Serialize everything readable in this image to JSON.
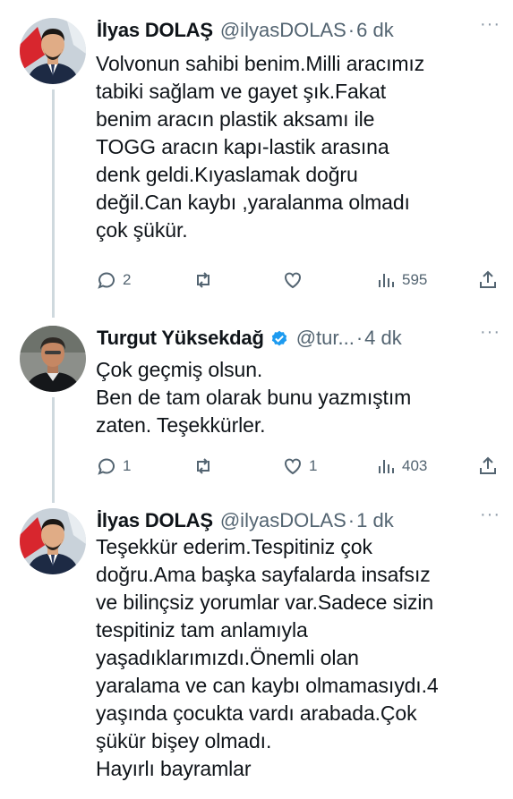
{
  "tweets": [
    {
      "name": "İlyas DOLAŞ",
      "handle": "@ilyasDOLAS",
      "time": "6 dk",
      "text": "Volvonun sahibi benim.Milli aracımız\ntabiki sağlam ve gayet şık.Fakat\nbenim aracın plastik aksamı ile\nTOGG aracın kapı-lastik arasına\ndenk geldi.Kıyaslamak doğru\ndeğil.Can kaybı ,yaralanma olmadı\nçok şükür.",
      "replies": "2",
      "retweets": "",
      "likes": "",
      "views": "595"
    },
    {
      "name": "Turgut Yüksekdağ",
      "handle": "@tur...",
      "time": "4 dk",
      "text": "Çok geçmiş olsun.\nBen de tam olarak bunu yazmıştım\nzaten. Teşekkürler.",
      "replies": "1",
      "retweets": "",
      "likes": "1",
      "views": "403"
    },
    {
      "name": "İlyas DOLAŞ",
      "handle": "@ilyasDOLAS",
      "time": "1 dk",
      "text": "Teşekkür ederim.Tespitiniz çok\ndoğru.Ama başka sayfalarda insafsız\nve bilinçsiz yorumlar var.Sadece sizin\ntespitiniz tam anlamıyla\nyaşadıklarımızdı.Önemli olan\nyaralama ve can kaybı olmamasıydı.4\nyaşında çocukta vardı arabada.Çok\nşükür bişey olmadı.\nHayırlı bayramlar"
    }
  ],
  "separator": "·",
  "more_icon": "···",
  "icons": {
    "reply": "reply-icon",
    "retweet": "retweet-icon",
    "like": "heart-icon",
    "views": "views-icon",
    "share": "share-icon",
    "verified": "verified-badge-icon"
  },
  "colors": {
    "text": "#0f1419",
    "secondary": "#536471",
    "verified": "#1d9bf0",
    "thread_line": "#cfd9de"
  }
}
